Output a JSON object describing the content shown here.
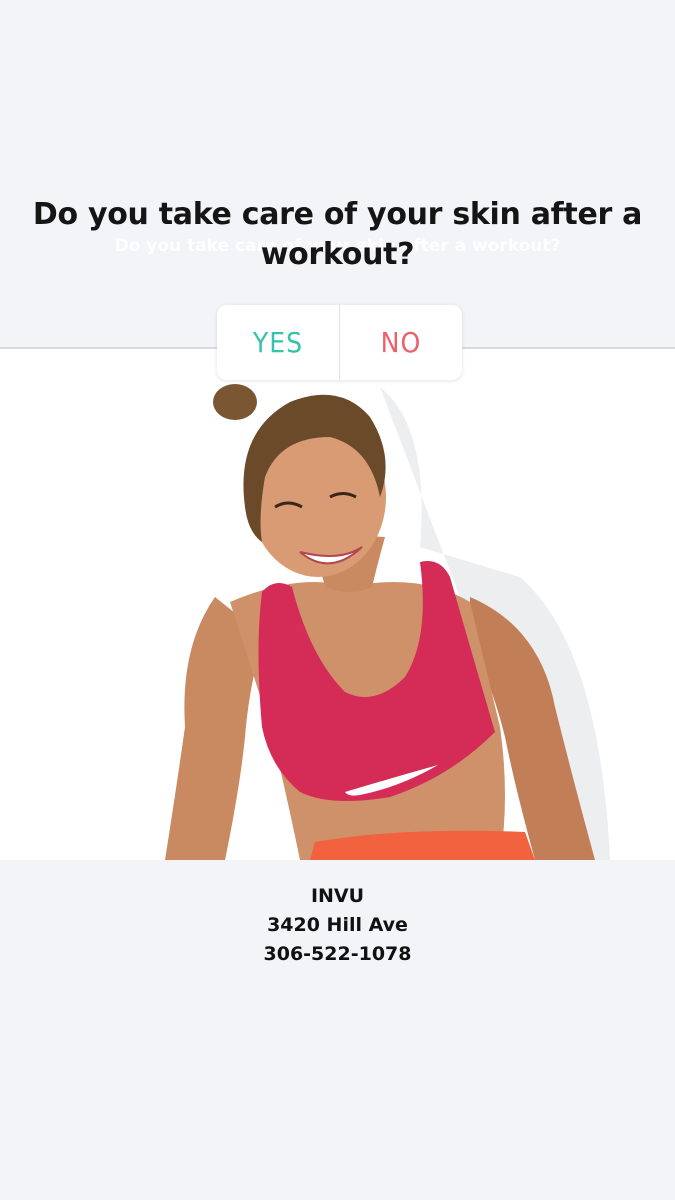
{
  "poll": {
    "question": "Do you take care of your skin after a workout?",
    "ghost_text": "Do you take care of your skin after a workout?",
    "options": [
      {
        "label": "YES",
        "color": "#33c3a8"
      },
      {
        "label": "NO",
        "color": "#ef5f6a"
      }
    ]
  },
  "business": {
    "name": "INVU",
    "address": "3420 Hill Ave",
    "phone": "306-522-1078"
  },
  "colors": {
    "background": "#f3f4f8",
    "sports_bra": "#d42b57",
    "shorts": "#f2623f"
  }
}
